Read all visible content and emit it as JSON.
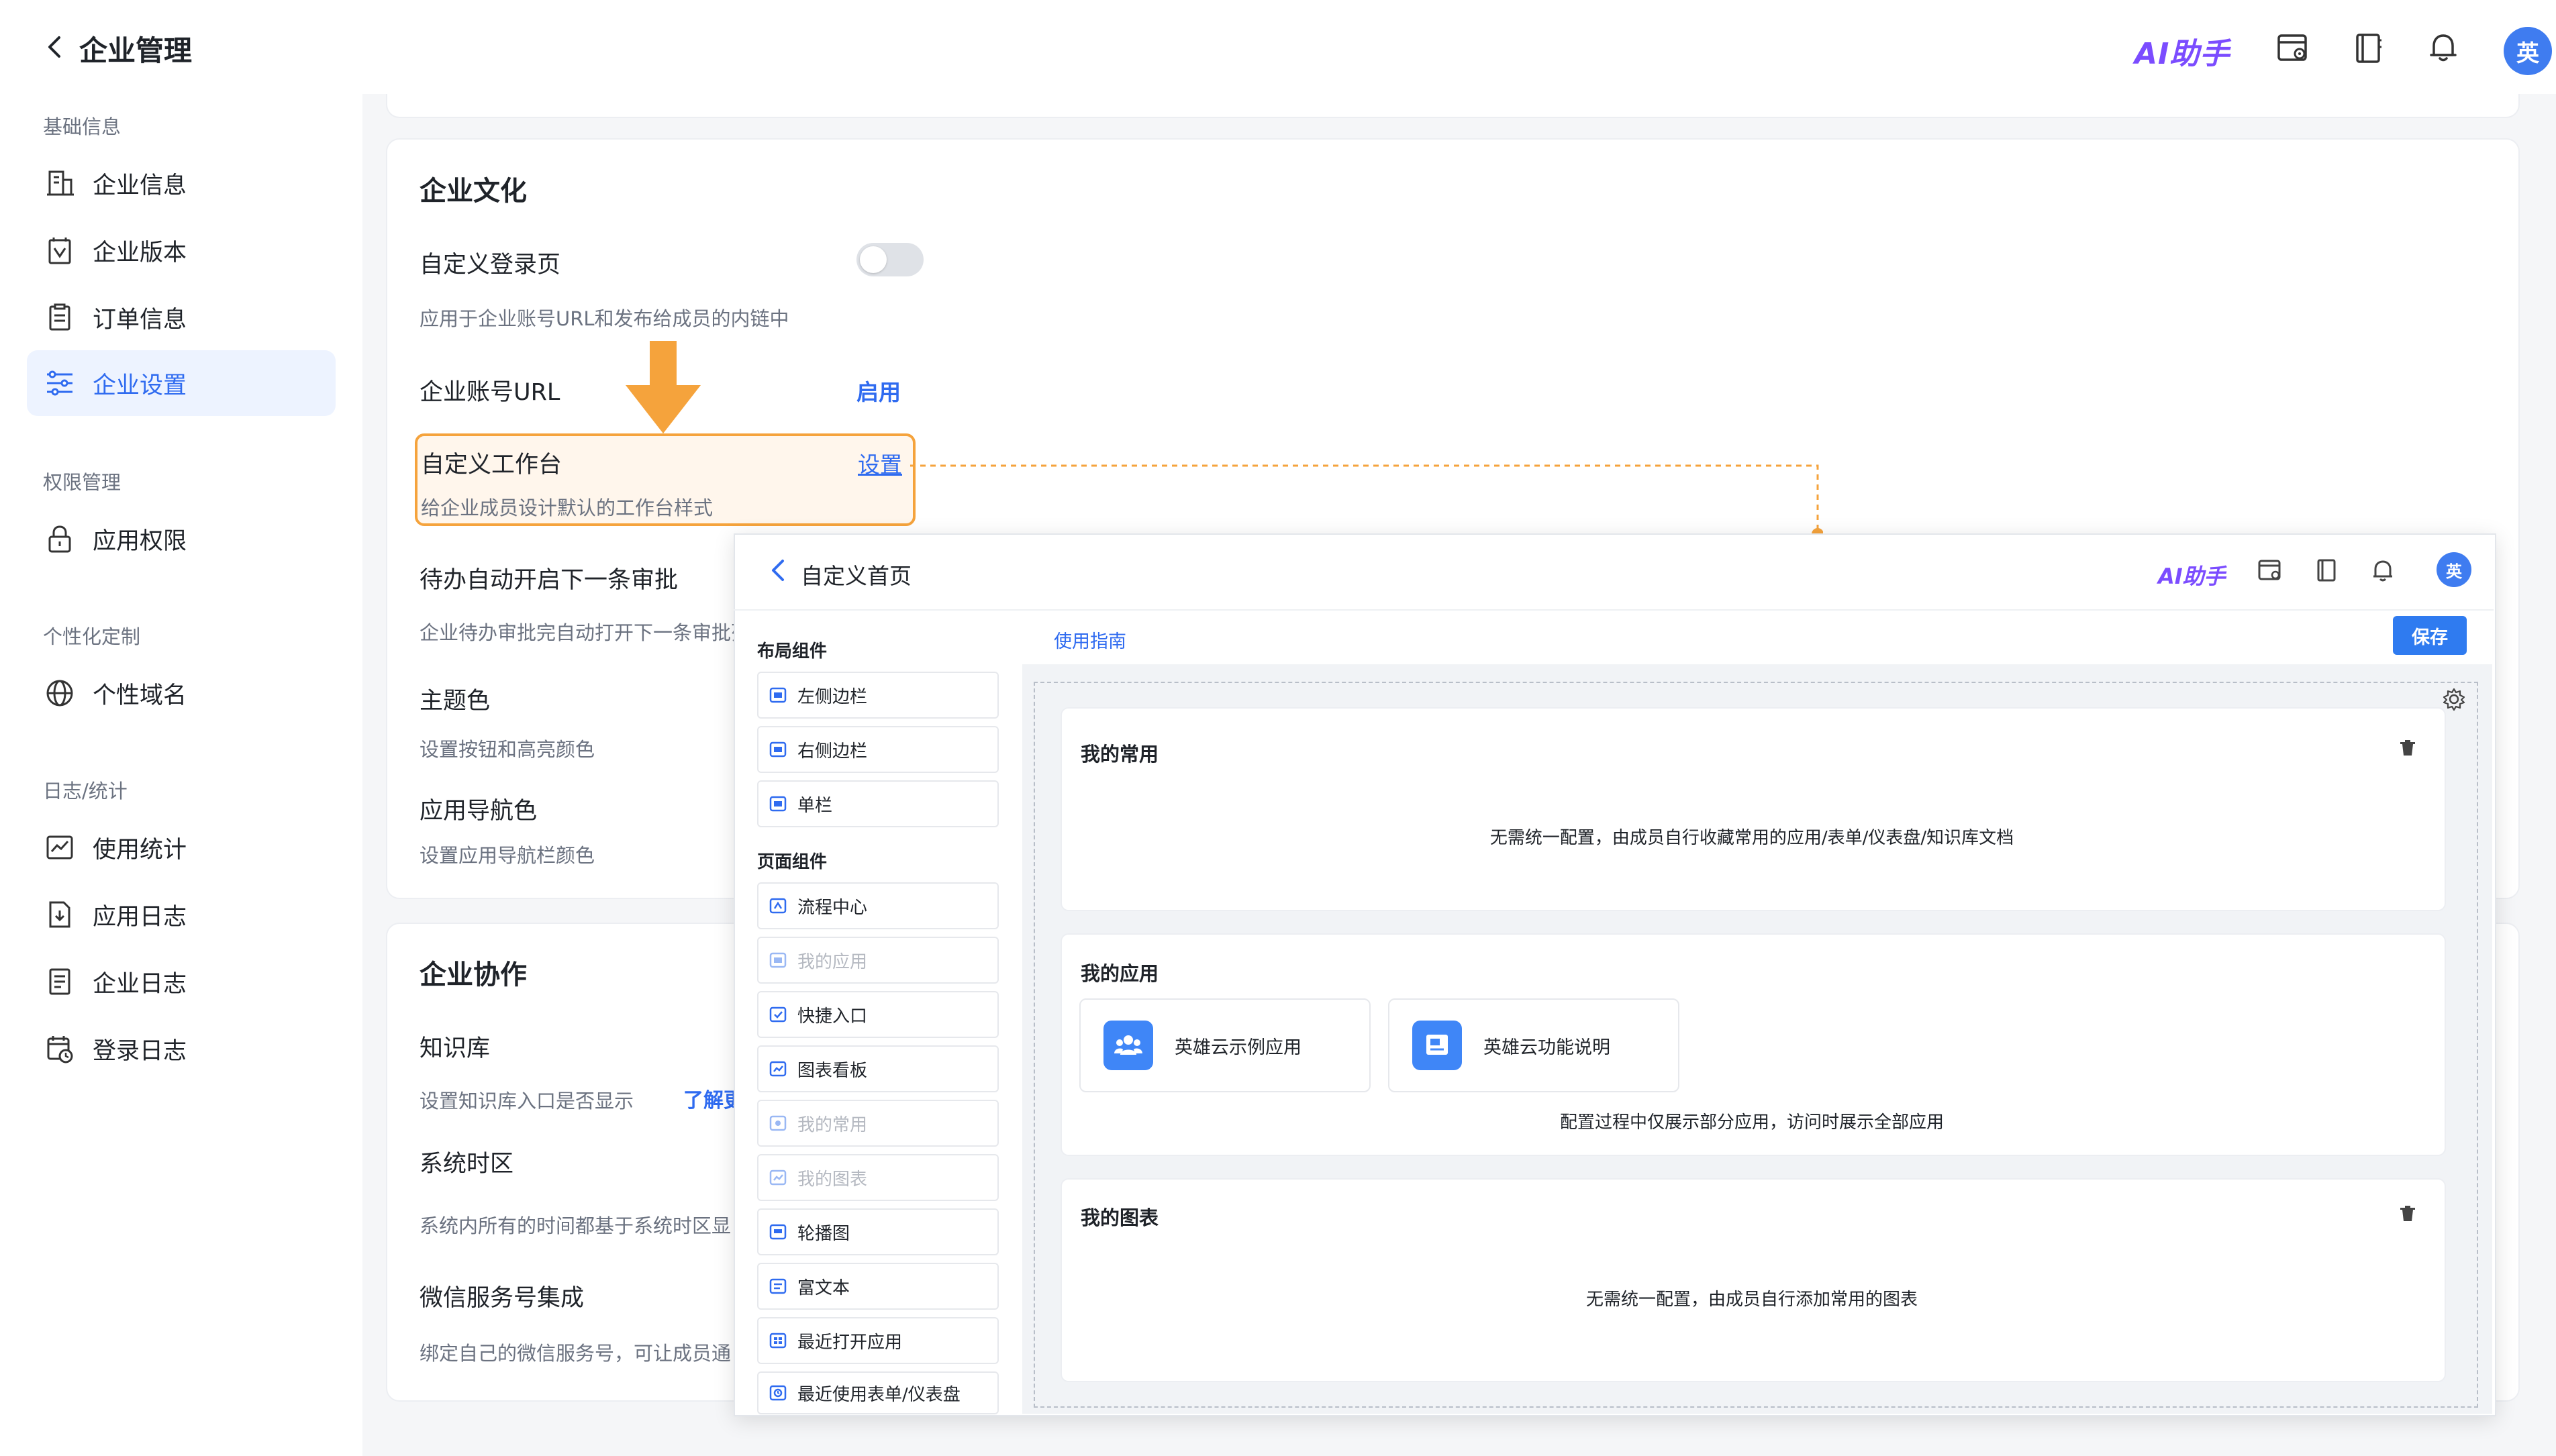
{
  "header": {
    "title": "企业管理",
    "ai_assistant_label": "AI助手",
    "avatar_text": "英",
    "icons": [
      "back-arrow-icon",
      "app-window-icon",
      "book-icon",
      "bell-icon"
    ]
  },
  "sidebar": {
    "sections": [
      {
        "title": "基础信息",
        "items": [
          {
            "label": "企业信息",
            "icon": "building-icon"
          },
          {
            "label": "企业版本",
            "icon": "version-icon"
          },
          {
            "label": "订单信息",
            "icon": "order-icon"
          },
          {
            "label": "企业设置",
            "icon": "settings-sliders-icon",
            "active": true
          }
        ]
      },
      {
        "title": "权限管理",
        "items": [
          {
            "label": "应用权限",
            "icon": "lock-icon"
          }
        ]
      },
      {
        "title": "个性化定制",
        "items": [
          {
            "label": "个性域名",
            "icon": "globe-icon"
          }
        ]
      },
      {
        "title": "日志/统计",
        "items": [
          {
            "label": "使用统计",
            "icon": "chart-line-icon"
          },
          {
            "label": "应用日志",
            "icon": "app-log-icon"
          },
          {
            "label": "企业日志",
            "icon": "doc-log-icon"
          },
          {
            "label": "登录日志",
            "icon": "calendar-clock-icon"
          }
        ]
      }
    ]
  },
  "culture": {
    "title": "企业文化",
    "custom_login": {
      "label": "自定义登录页",
      "desc": "应用于企业账号URL和发布给成员的内链中",
      "enabled": false
    },
    "account_url": {
      "label": "企业账号URL",
      "action": "启用"
    },
    "custom_workbench": {
      "label": "自定义工作台",
      "action": "设置",
      "desc": "给企业成员设计默认的工作台样式"
    },
    "auto_next": {
      "label": "待办自动开启下一条审批",
      "desc": "企业待办审批完自动打开下一条审批列"
    },
    "theme_color": {
      "label": "主题色",
      "desc": "设置按钮和高亮颜色"
    },
    "nav_color": {
      "label": "应用导航色",
      "desc": "设置应用导航栏颜色"
    }
  },
  "collab": {
    "title": "企业协作",
    "knowledge": {
      "label": "知识库",
      "desc": "设置知识库入口是否显示",
      "link": "了解更"
    },
    "timezone": {
      "label": "系统时区",
      "desc": "系统内所有的时间都基于系统时区显"
    },
    "wechat": {
      "label": "微信服务号集成",
      "desc": "绑定自己的微信服务号，可让成员通"
    }
  },
  "panel": {
    "title": "自定义首页",
    "ai_assistant_label": "AI助手",
    "avatar_text": "英",
    "guide_link": "使用指南",
    "save_label": "保存",
    "layout_group": "布局组件",
    "layout_items": [
      {
        "label": "左侧边栏",
        "disabled": false
      },
      {
        "label": "右侧边栏",
        "disabled": false
      },
      {
        "label": "单栏",
        "disabled": false
      }
    ],
    "page_group": "页面组件",
    "page_items": [
      {
        "label": "流程中心",
        "disabled": false
      },
      {
        "label": "我的应用",
        "disabled": true
      },
      {
        "label": "快捷入口",
        "disabled": false
      },
      {
        "label": "图表看板",
        "disabled": false
      },
      {
        "label": "我的常用",
        "disabled": true
      },
      {
        "label": "我的图表",
        "disabled": true
      },
      {
        "label": "轮播图",
        "disabled": false
      },
      {
        "label": "富文本",
        "disabled": false
      },
      {
        "label": "最近打开应用",
        "disabled": false
      },
      {
        "label": "最近使用表单/仪表盘",
        "disabled": false
      }
    ],
    "widgets": {
      "common": {
        "title": "我的常用",
        "desc": "无需统一配置，由成员自行收藏常用的应用/表单/仪表盘/知识库文档"
      },
      "apps": {
        "title": "我的应用",
        "apps": [
          "英雄云示例应用",
          "英雄云功能说明"
        ],
        "desc": "配置过程中仅展示部分应用，访问时展示全部应用"
      },
      "charts": {
        "title": "我的图表",
        "desc": "无需统一配置，由成员自行添加常用的图表"
      }
    }
  },
  "colors": {
    "accent": "#2f6bf0",
    "highlight": "#f5a33c",
    "ai_purple": "#7b4cff",
    "active_bg": "#edf3ff"
  }
}
